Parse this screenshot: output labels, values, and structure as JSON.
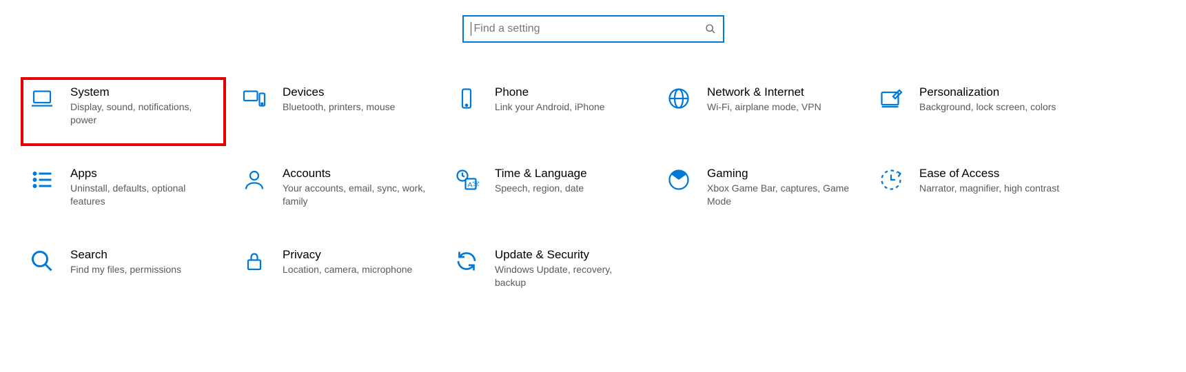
{
  "search": {
    "placeholder": "Find a setting"
  },
  "tiles": [
    {
      "title": "System",
      "desc": "Display, sound, notifications, power",
      "highlight": true
    },
    {
      "title": "Devices",
      "desc": "Bluetooth, printers, mouse"
    },
    {
      "title": "Phone",
      "desc": "Link your Android, iPhone"
    },
    {
      "title": "Network & Internet",
      "desc": "Wi-Fi, airplane mode, VPN"
    },
    {
      "title": "Personalization",
      "desc": "Background, lock screen, colors"
    },
    {
      "title": "Apps",
      "desc": "Uninstall, defaults, optional features"
    },
    {
      "title": "Accounts",
      "desc": "Your accounts, email, sync, work, family"
    },
    {
      "title": "Time & Language",
      "desc": "Speech, region, date"
    },
    {
      "title": "Gaming",
      "desc": "Xbox Game Bar, captures, Game Mode"
    },
    {
      "title": "Ease of Access",
      "desc": "Narrator, magnifier, high contrast"
    },
    {
      "title": "Search",
      "desc": "Find my files, permissions"
    },
    {
      "title": "Privacy",
      "desc": "Location, camera, microphone"
    },
    {
      "title": "Update & Security",
      "desc": "Windows Update, recovery, backup"
    }
  ]
}
